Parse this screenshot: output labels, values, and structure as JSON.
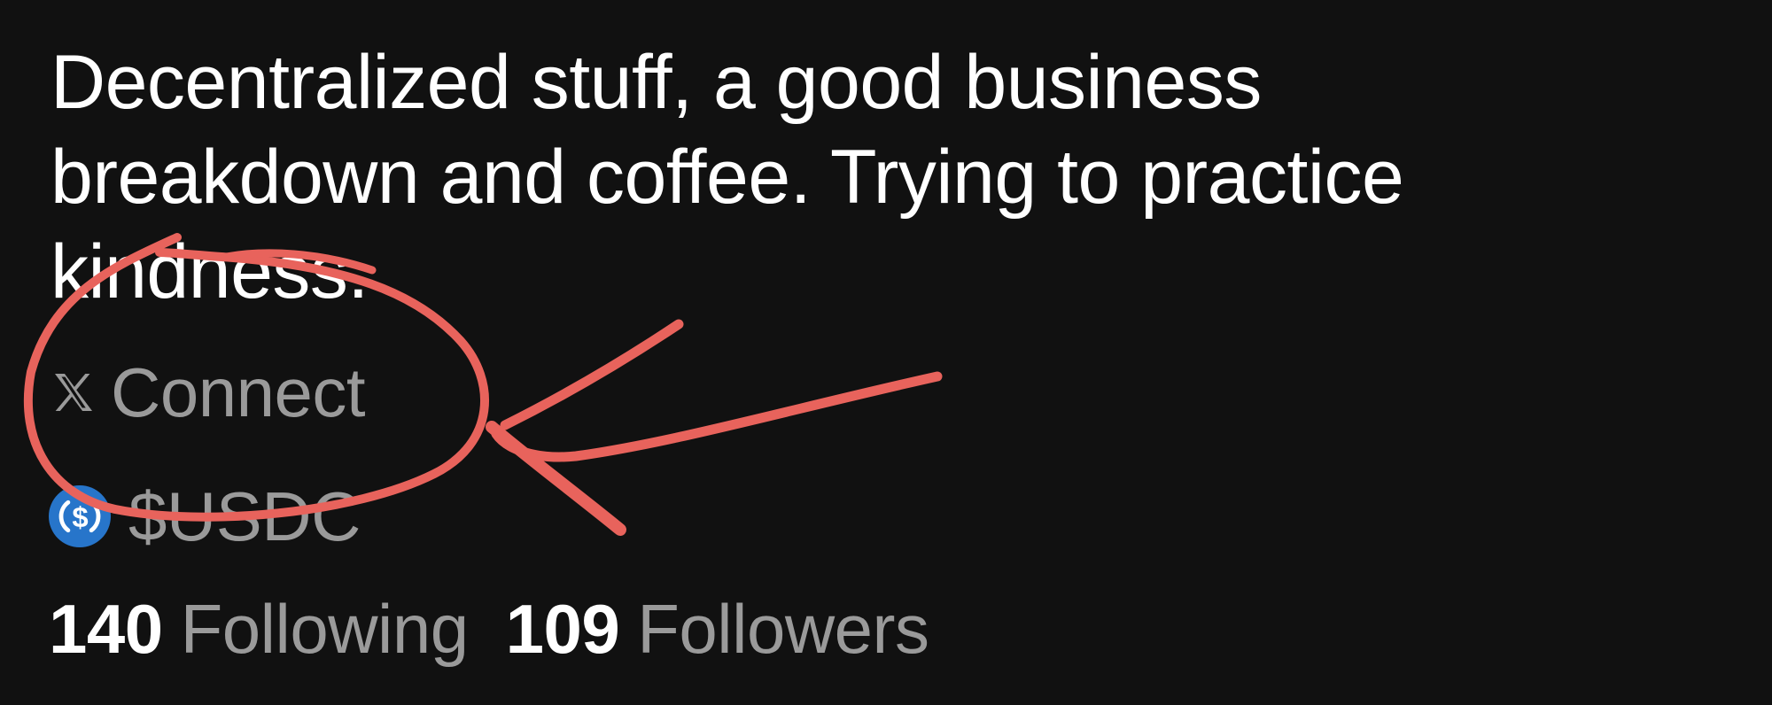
{
  "profile": {
    "bio": "Decentralized stuff, a good business\nbreakdown and coffee. Trying to practice\nkindness.",
    "connect": {
      "icon": "x-logo-icon",
      "label": "Connect"
    },
    "token": {
      "icon": "usdc-coin-icon",
      "label": "$USDC",
      "icon_color": "#2775ca"
    },
    "stats": {
      "following_count": "140",
      "following_label": "Following",
      "followers_count": "109",
      "followers_label": "Followers"
    }
  },
  "annotation": {
    "type": "hand-drawn circle and arrow",
    "color": "#e8635c"
  }
}
